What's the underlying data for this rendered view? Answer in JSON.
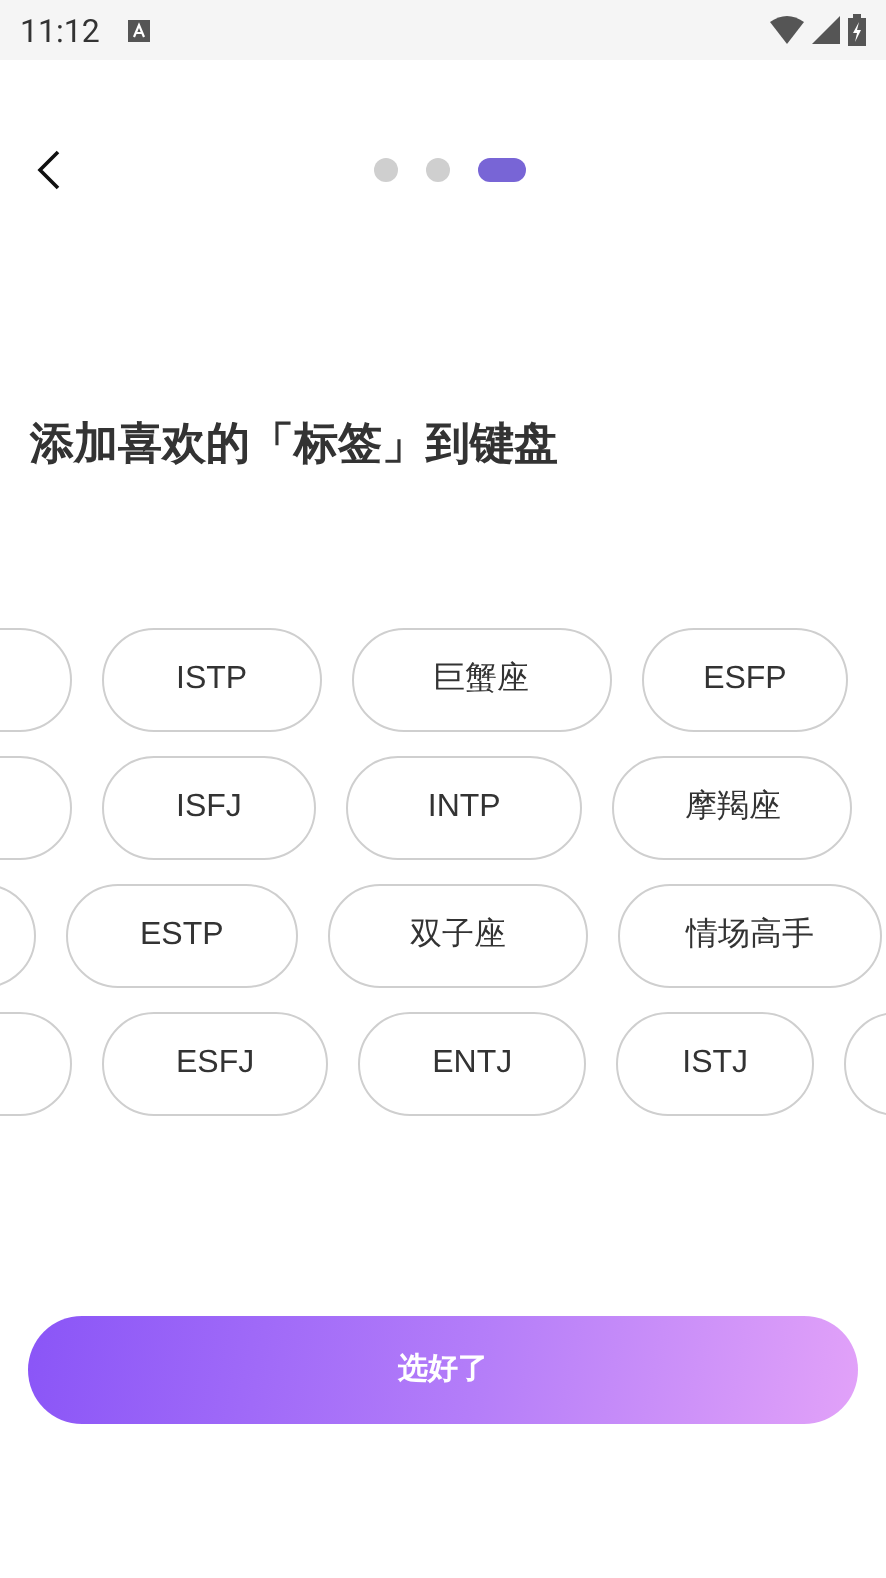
{
  "status_bar": {
    "time": "11:12"
  },
  "pager": [
    {
      "selected": false
    },
    {
      "selected": false
    },
    {
      "selected": true
    }
  ],
  "title": "添加喜欢的「标签」到键盘",
  "tag_rows": [
    {
      "tags": [
        {
          "kind": "clipped"
        },
        {
          "kind": "tag",
          "label": "ISTP"
        },
        {
          "kind": "tag",
          "label": "巨蟹座"
        },
        {
          "kind": "tag",
          "label": "ESFP"
        }
      ]
    },
    {
      "tags": [
        {
          "kind": "clipped"
        },
        {
          "kind": "tag",
          "label": "ISFJ"
        },
        {
          "kind": "tag",
          "label": "INTP"
        },
        {
          "kind": "tag",
          "label": "摩羯座"
        }
      ]
    },
    {
      "tags": [
        {
          "kind": "clipped"
        },
        {
          "kind": "tag",
          "label": "ESTP"
        },
        {
          "kind": "tag",
          "label": "双子座"
        },
        {
          "kind": "tag",
          "label": "情场高手"
        }
      ]
    },
    {
      "tags": [
        {
          "kind": "clipped"
        },
        {
          "kind": "tag",
          "label": "ESFJ"
        },
        {
          "kind": "tag",
          "label": "ENTJ"
        },
        {
          "kind": "tag",
          "label": "ISTJ"
        },
        {
          "kind": "clipped"
        }
      ]
    }
  ],
  "confirm_button": "选好了"
}
